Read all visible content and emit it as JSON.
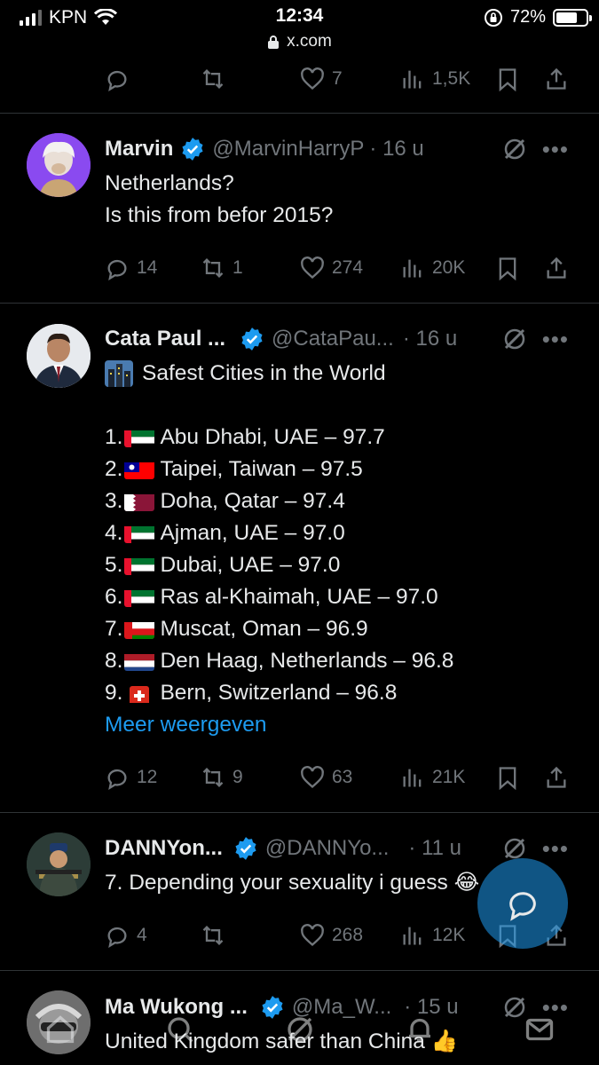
{
  "status": {
    "carrier": "KPN",
    "time": "12:34",
    "url": "x.com",
    "battery": "72%",
    "battery_level": 0.72
  },
  "top_actions": {
    "reply": "",
    "retweet": "",
    "like": "7",
    "views": "1,5K"
  },
  "tweets": [
    {
      "name": "Marvin",
      "handle": "@MarvinHarryP",
      "time": "· 16 u",
      "text": "Netherlands?\nIs this from befor 2015?",
      "reply": "14",
      "retweet": "1",
      "like": "274",
      "views": "20K"
    },
    {
      "name": "Cata Paul ...",
      "handle": "@CataPau...",
      "time": "· 16 u",
      "title": "Safest Cities in the World",
      "items": [
        {
          "num": "1.",
          "flag": "uae",
          "text": "Abu Dhabi, UAE – 97.7"
        },
        {
          "num": "2.",
          "flag": "taiwan",
          "text": "Taipei, Taiwan – 97.5"
        },
        {
          "num": "3.",
          "flag": "qatar",
          "text": "Doha, Qatar – 97.4"
        },
        {
          "num": "4.",
          "flag": "uae",
          "text": "Ajman, UAE – 97.0"
        },
        {
          "num": "5.",
          "flag": "uae",
          "text": "Dubai, UAE – 97.0"
        },
        {
          "num": "6.",
          "flag": "uae",
          "text": "Ras al-Khaimah, UAE – 97.0"
        },
        {
          "num": "7.",
          "flag": "oman",
          "text": "Muscat, Oman – 96.9"
        },
        {
          "num": "8.",
          "flag": "netherlands",
          "text": "Den Haag, Netherlands – 96.8"
        },
        {
          "num": "9.",
          "flag": "switzerland",
          "text": "Bern, Switzerland – 96.8"
        }
      ],
      "show_more": "Meer weergeven",
      "reply": "12",
      "retweet": "9",
      "like": "63",
      "views": "21K"
    },
    {
      "name": "DANNYon...",
      "handle": "@DANNYo...",
      "time": "· 11 u",
      "text": "7. Depending your sexuality i guess 😂",
      "reply": "4",
      "retweet": "",
      "like": "268",
      "views": "12K"
    },
    {
      "name": "Ma Wukong ...",
      "handle": "@Ma_W...",
      "time": "· 15 u",
      "text": "United Kingdom safer than China 👍"
    }
  ],
  "colors": {
    "accent": "#1d9bf0",
    "muted": "#71767b",
    "text": "#e7e9ea",
    "divider": "#2f3336"
  }
}
